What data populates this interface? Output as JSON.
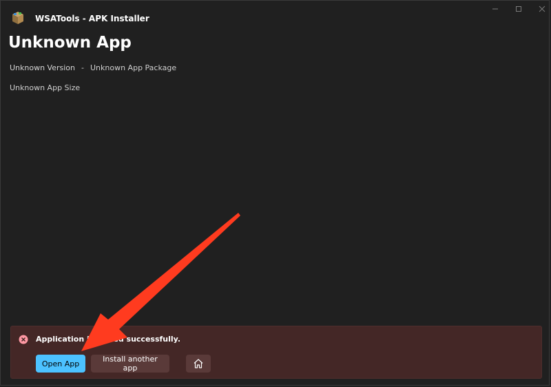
{
  "window": {
    "title": "WSATools - APK Installer",
    "caption_icons": [
      "minimize-icon",
      "maximize-icon",
      "close-icon"
    ]
  },
  "app": {
    "name": "Unknown App",
    "version": "Unknown Version",
    "separator": "-",
    "package": "Unknown App Package",
    "size": "Unknown App Size"
  },
  "infobar": {
    "status": "error",
    "message": "Application installed successfully.",
    "buttons": {
      "open_app": "Open App",
      "install_another": "Install another app"
    },
    "icons": [
      "error-icon",
      "home-icon"
    ]
  },
  "colors": {
    "background": "#202020",
    "infobar_bg": "#442726",
    "accent": "#4cc2ff",
    "error": "#ff99a4",
    "annotation_arrow": "#ff3b1f"
  }
}
